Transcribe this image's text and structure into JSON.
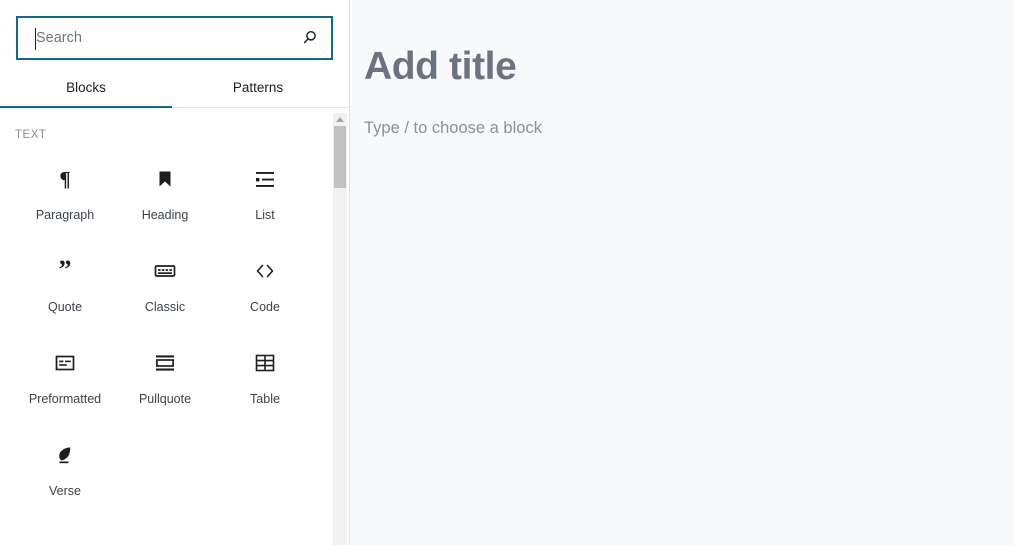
{
  "inserter": {
    "search": {
      "placeholder": "Search",
      "value": "",
      "icon": "search-icon"
    },
    "tabs": [
      {
        "label": "Blocks",
        "active": true
      },
      {
        "label": "Patterns",
        "active": false
      }
    ],
    "categories": [
      {
        "title": "TEXT",
        "blocks": [
          {
            "label": "Paragraph",
            "icon": "paragraph-pilcrow-icon"
          },
          {
            "label": "Heading",
            "icon": "heading-bookmark-icon"
          },
          {
            "label": "List",
            "icon": "list-bullet-icon"
          },
          {
            "label": "Quote",
            "icon": "quote-marks-icon"
          },
          {
            "label": "Classic",
            "icon": "classic-keyboard-icon"
          },
          {
            "label": "Code",
            "icon": "code-angle-brackets-icon"
          },
          {
            "label": "Preformatted",
            "icon": "preformatted-box-icon"
          },
          {
            "label": "Pullquote",
            "icon": "pullquote-bars-icon"
          },
          {
            "label": "Table",
            "icon": "table-grid-icon"
          },
          {
            "label": "Verse",
            "icon": "verse-leaf-icon"
          }
        ]
      }
    ],
    "scrollbar": {
      "up_arrow": "scroll-up-arrow-icon"
    }
  },
  "editor": {
    "title_placeholder": "Add title",
    "body_placeholder": "Type / to choose a block"
  },
  "colors": {
    "accent": "#10688f",
    "sidebar_bg": "#ffffff",
    "canvas_bg": "#f8f9fb",
    "title_text": "#6b7280",
    "body_text": "#8b9097",
    "category_text": "#8d8d8d",
    "icon": "#1e1e1e",
    "scroll_thumb": "#c1c1c1",
    "scroll_track": "#f1f1f1"
  }
}
